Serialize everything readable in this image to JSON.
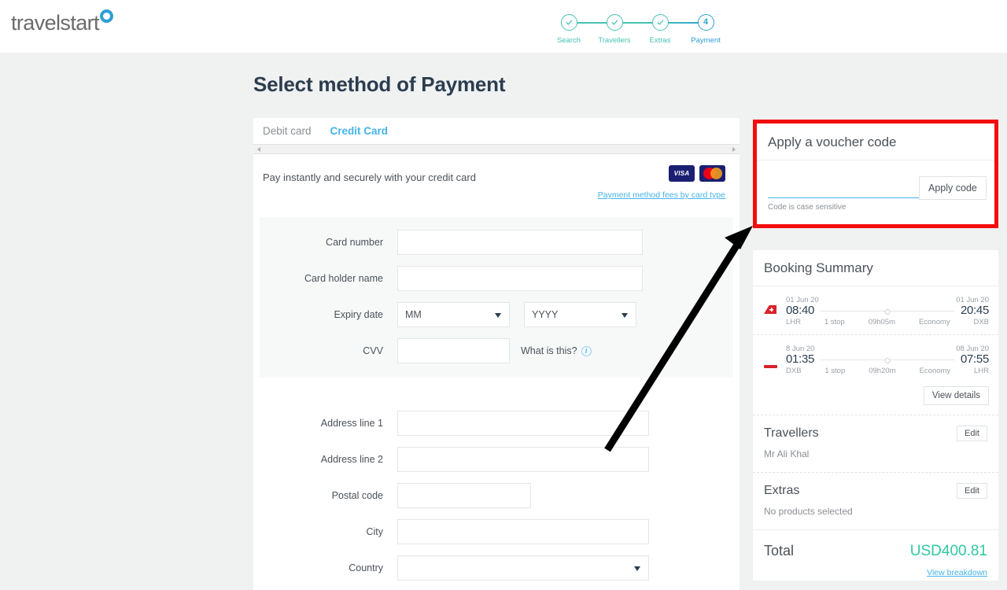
{
  "header": {
    "logo_text": "travelstart",
    "steps": [
      {
        "label": "Search",
        "state": "done",
        "marker": "check"
      },
      {
        "label": "Travellers",
        "state": "done",
        "marker": "check"
      },
      {
        "label": "Extras",
        "state": "done",
        "marker": "check"
      },
      {
        "label": "Payment",
        "state": "current",
        "marker": "4"
      }
    ]
  },
  "page": {
    "title": "Select method of Payment"
  },
  "payment": {
    "tabs": [
      {
        "label": "Debit card",
        "active": false
      },
      {
        "label": "Credit Card",
        "active": true
      }
    ],
    "intro_text": "Pay instantly and securely with your credit card",
    "fees_link": "Payment method fees by card type",
    "card_brands": [
      "VISA",
      "MasterCard"
    ],
    "card_fields": [
      {
        "label": "Card number",
        "value": "",
        "type": "text"
      },
      {
        "label": "Card holder name",
        "value": "",
        "type": "text"
      }
    ],
    "expiry": {
      "label": "Expiry date",
      "month_value": "MM",
      "year_value": "YYYY"
    },
    "cvv": {
      "label": "CVV",
      "value": "",
      "help_text": "What is this?",
      "info_glyph": "i"
    },
    "address_fields": [
      {
        "label": "Address line 1",
        "value": "",
        "type": "text"
      },
      {
        "label": "Address line 2",
        "value": "",
        "type": "text"
      },
      {
        "label": "Postal code",
        "value": "",
        "type": "text"
      },
      {
        "label": "City",
        "value": "",
        "type": "text"
      },
      {
        "label": "Country",
        "value": "",
        "type": "select"
      }
    ]
  },
  "voucher": {
    "title": "Apply a voucher code",
    "input_value": "",
    "apply_label": "Apply code",
    "note": "Code is case sensitive",
    "highlight_color": "#f40d0d"
  },
  "summary": {
    "title": "Booking Summary",
    "flights": [
      {
        "airline_icon": "swiss-tail-icon",
        "depart_date": "01 Jun 20",
        "depart_time": "08:40",
        "depart_code": "LHR",
        "stops": "1 stop",
        "duration": "09h05m",
        "cabin": "Economy",
        "arrive_date": "01 Jun 20",
        "arrive_time": "20:45",
        "arrive_code": "DXB"
      },
      {
        "airline_icon": "red-dash-icon",
        "depart_date": "8 Jun 20",
        "depart_time": "01:35",
        "depart_code": "DXB",
        "stops": "1 stop",
        "duration": "09h20m",
        "cabin": "Economy",
        "arrive_date": "08 Jun 20",
        "arrive_time": "07:55",
        "arrive_code": "LHR"
      }
    ],
    "view_details_label": "View details",
    "travellers": {
      "title": "Travellers",
      "edit_label": "Edit",
      "value": "Mr Ali Khal"
    },
    "extras": {
      "title": "Extras",
      "edit_label": "Edit",
      "value": "No products selected"
    },
    "total": {
      "label": "Total",
      "value": "USD400.81",
      "color": "#2fc9a0",
      "breakdown_label": "View breakdown"
    }
  }
}
